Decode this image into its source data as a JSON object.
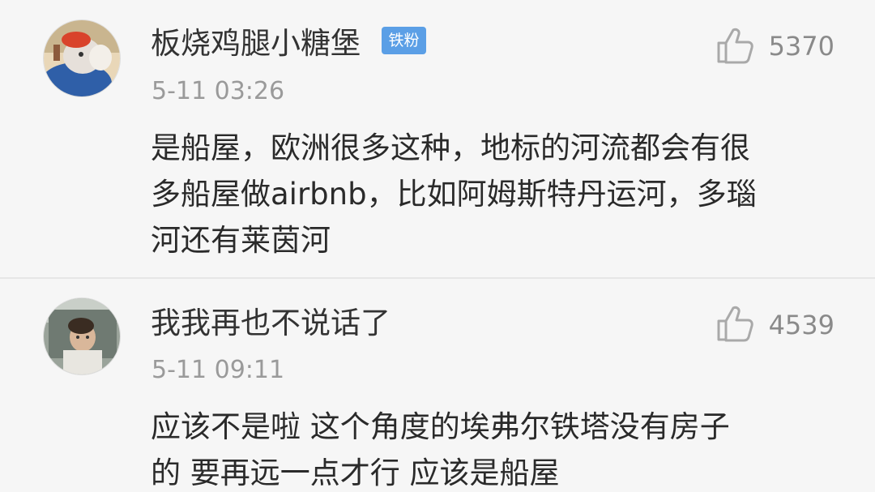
{
  "comments": [
    {
      "username": "板烧鸡腿小糖堡",
      "badge": "铁粉",
      "likes": "5370",
      "time": "5-11 03:26",
      "text_lines": [
        "是船屋，欧洲很多这种，地标的河流都会有很",
        "多船屋做airbnb，比如阿姆斯特丹运河，多瑙",
        "河还有莱茵河"
      ]
    },
    {
      "username": "我我再也不说话了",
      "likes": "4539",
      "time": "5-11 09:11",
      "text_lines": [
        "应该不是啦 这个角度的埃弗尔铁塔没有房子",
        "的 要再远一点才行 应该是船屋"
      ]
    }
  ],
  "icons": {
    "like": "thumbs-up-icon"
  },
  "colors": {
    "background": "#f6f6f6",
    "username": "#333333",
    "badge": "#5b9fe6",
    "meta": "#9a9a9a",
    "body_text": "#2a2a2a"
  }
}
